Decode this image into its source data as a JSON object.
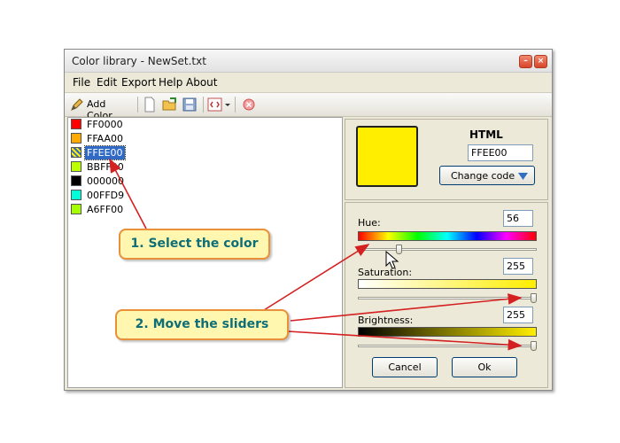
{
  "window": {
    "title": "Color library - NewSet.txt"
  },
  "menu": [
    "File",
    "Edit",
    "Export",
    "Help",
    "About"
  ],
  "toolbar": {
    "add_color_label": "Add Color"
  },
  "colors": [
    {
      "hex": "FF0000",
      "color": "#FF0000"
    },
    {
      "hex": "FFAA00",
      "color": "#FFAA00"
    },
    {
      "hex": "FFEE00",
      "color": "#FFEE00",
      "selected": true
    },
    {
      "hex": "BBFF00",
      "color": "#BBFF00"
    },
    {
      "hex": "000000",
      "color": "#000000"
    },
    {
      "hex": "00FFD9",
      "color": "#00FFD9"
    },
    {
      "hex": "A6FF00",
      "color": "#A6FF00"
    }
  ],
  "preview": {
    "color": "#FFEE00",
    "html_label": "HTML",
    "html_value": "FFEE00",
    "change_code_label": "Change code"
  },
  "sliders": {
    "hue": {
      "label": "Hue:",
      "value": "56",
      "level": 0.22
    },
    "saturation": {
      "label": "Saturation:",
      "value": "255",
      "level": 1.0
    },
    "brightness": {
      "label": "Brightness:",
      "value": "255",
      "level": 1.0
    }
  },
  "buttons": {
    "cancel": "Cancel",
    "ok": "Ok"
  },
  "annotations": {
    "step1": "1. Select the color",
    "step2": "2. Move the sliders"
  }
}
